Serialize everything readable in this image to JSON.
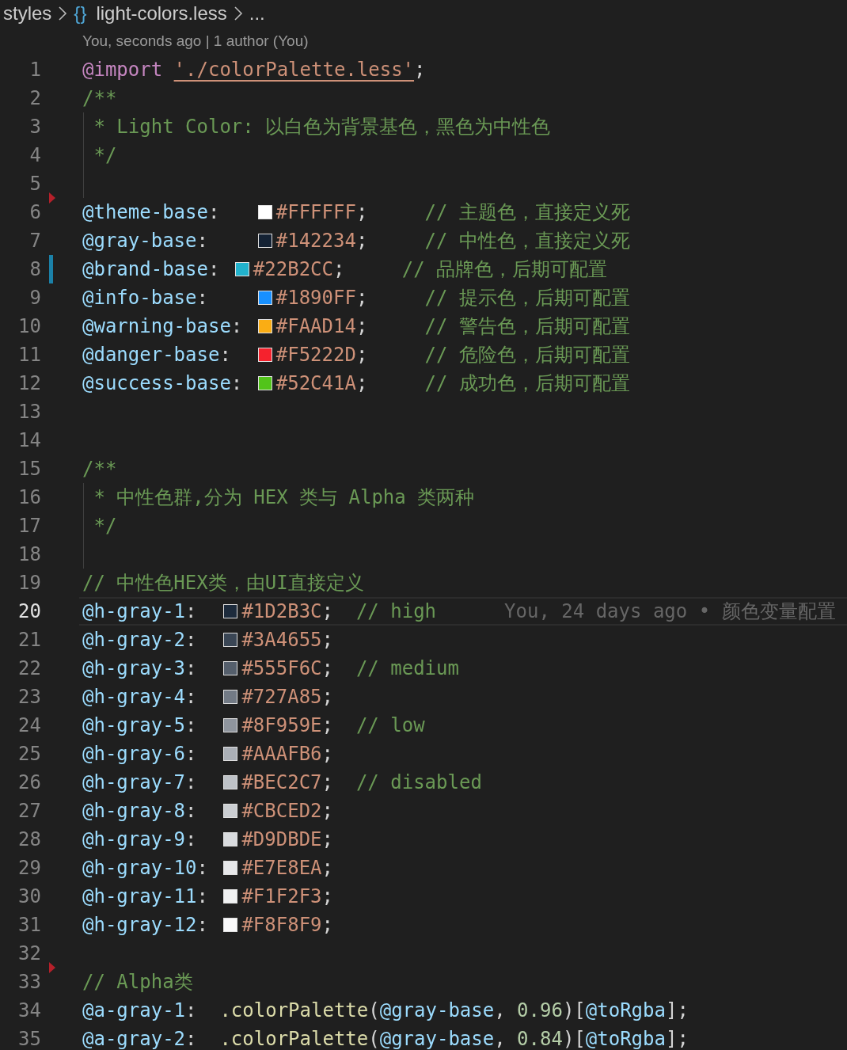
{
  "breadcrumbs": [
    {
      "text": "styles"
    },
    {
      "icon": "{}",
      "text": "light-colors.less"
    },
    {
      "text": "..."
    }
  ],
  "codelens": "You, seconds ago | 1 author (You)",
  "lines": [
    {
      "number": "1",
      "current": false,
      "guide": false,
      "modified": false,
      "deleted": false,
      "tokens": [
        {
          "kind": "kw",
          "text": "@import"
        },
        {
          "kind": "str",
          "text": "'./colorPalette.less'"
        },
        {
          "kind": "punct",
          "text": ";"
        }
      ]
    },
    {
      "number": "2",
      "current": false,
      "guide": false,
      "modified": false,
      "deleted": false,
      "tokens": [
        {
          "kind": "cmt",
          "text": "/**"
        }
      ]
    },
    {
      "number": "3",
      "current": false,
      "guide": true,
      "modified": false,
      "deleted": false,
      "tokens": [
        {
          "kind": "cmt",
          "text": " * Light Color: 以白色为背景基色，黑色为中性色"
        }
      ]
    },
    {
      "number": "4",
      "current": false,
      "guide": true,
      "modified": false,
      "deleted": false,
      "tokens": [
        {
          "kind": "cmt",
          "text": " */"
        }
      ]
    },
    {
      "number": "5",
      "current": false,
      "guide": true,
      "modified": false,
      "deleted": false
    },
    {
      "number": "6",
      "current": false,
      "guide": false,
      "modified": false,
      "deleted": true,
      "tokens": [
        {
          "kind": "var",
          "text": "@theme-base"
        },
        {
          "kind": "punct",
          "text": ":   "
        },
        {
          "kind": "swatch",
          "color": "#ffffff"
        },
        {
          "kind": "hex",
          "text": "#FFFFFF"
        },
        {
          "kind": "punct",
          "text": ";     "
        },
        {
          "kind": "cmt",
          "text": "// 主题色，直接定义死"
        }
      ]
    },
    {
      "number": "7",
      "current": false,
      "guide": false,
      "modified": false,
      "deleted": false,
      "tokens": [
        {
          "kind": "var",
          "text": "@gray-base"
        },
        {
          "kind": "punct",
          "text": ":    "
        },
        {
          "kind": "swatch",
          "color": "#142234"
        },
        {
          "kind": "hex",
          "text": "#142234"
        },
        {
          "kind": "punct",
          "text": ";     "
        },
        {
          "kind": "cmt",
          "text": "// 中性色，直接定义死"
        }
      ]
    },
    {
      "number": "8",
      "current": false,
      "guide": false,
      "modified": true,
      "deleted": false,
      "tokens": [
        {
          "kind": "var",
          "text": "@brand-base"
        },
        {
          "kind": "punct",
          "text": ": "
        },
        {
          "kind": "swatch",
          "color": "#22b2cc"
        },
        {
          "kind": "hex",
          "text": "#22B2CC"
        },
        {
          "kind": "punct",
          "text": ";     "
        },
        {
          "kind": "cmt",
          "text": "// 品牌色，后期可配置"
        }
      ]
    },
    {
      "number": "9",
      "current": false,
      "guide": false,
      "modified": false,
      "deleted": false,
      "tokens": [
        {
          "kind": "var",
          "text": "@info-base"
        },
        {
          "kind": "punct",
          "text": ":    "
        },
        {
          "kind": "swatch",
          "color": "#1890ff"
        },
        {
          "kind": "hex",
          "text": "#1890FF"
        },
        {
          "kind": "punct",
          "text": ";     "
        },
        {
          "kind": "cmt",
          "text": "// 提示色，后期可配置"
        }
      ]
    },
    {
      "number": "10",
      "current": false,
      "guide": false,
      "modified": false,
      "deleted": false,
      "tokens": [
        {
          "kind": "var",
          "text": "@warning-base"
        },
        {
          "kind": "punct",
          "text": ": "
        },
        {
          "kind": "swatch",
          "color": "#faad14"
        },
        {
          "kind": "hex",
          "text": "#FAAD14"
        },
        {
          "kind": "punct",
          "text": ";     "
        },
        {
          "kind": "cmt",
          "text": "// 警告色，后期可配置"
        }
      ]
    },
    {
      "number": "11",
      "current": false,
      "guide": false,
      "modified": false,
      "deleted": false,
      "tokens": [
        {
          "kind": "var",
          "text": "@danger-base"
        },
        {
          "kind": "punct",
          "text": ":  "
        },
        {
          "kind": "swatch",
          "color": "#f5222d"
        },
        {
          "kind": "hex",
          "text": "#F5222D"
        },
        {
          "kind": "punct",
          "text": ";     "
        },
        {
          "kind": "cmt",
          "text": "// 危险色，后期可配置"
        }
      ]
    },
    {
      "number": "12",
      "current": false,
      "guide": false,
      "modified": false,
      "deleted": false,
      "tokens": [
        {
          "kind": "var",
          "text": "@success-base"
        },
        {
          "kind": "punct",
          "text": ": "
        },
        {
          "kind": "swatch",
          "color": "#52c41a"
        },
        {
          "kind": "hex",
          "text": "#52C41A"
        },
        {
          "kind": "punct",
          "text": ";     "
        },
        {
          "kind": "cmt",
          "text": "// 成功色，后期可配置"
        }
      ]
    },
    {
      "number": "13",
      "current": false,
      "guide": false,
      "modified": false,
      "deleted": false
    },
    {
      "number": "14",
      "current": false,
      "guide": false,
      "modified": false,
      "deleted": false
    },
    {
      "number": "15",
      "current": false,
      "guide": false,
      "modified": false,
      "deleted": false,
      "tokens": [
        {
          "kind": "cmt",
          "text": "/**"
        }
      ]
    },
    {
      "number": "16",
      "current": false,
      "guide": true,
      "modified": false,
      "deleted": false,
      "tokens": [
        {
          "kind": "cmt",
          "text": " * 中性色群,分为 HEX 类与 Alpha 类两种"
        }
      ]
    },
    {
      "number": "17",
      "current": false,
      "guide": true,
      "modified": false,
      "deleted": false,
      "tokens": [
        {
          "kind": "cmt",
          "text": " */"
        }
      ]
    },
    {
      "number": "18",
      "current": false,
      "guide": true,
      "modified": false,
      "deleted": false
    },
    {
      "number": "19",
      "current": false,
      "guide": false,
      "modified": false,
      "deleted": false,
      "tokens": [
        {
          "kind": "cmt",
          "text": "// 中性色HEX类，由UI直接定义"
        }
      ]
    },
    {
      "number": "20",
      "current": true,
      "guide": false,
      "modified": false,
      "deleted": false,
      "tokens": [
        {
          "kind": "var",
          "text": "@h-gray-1"
        },
        {
          "kind": "punct",
          "text": ":  "
        },
        {
          "kind": "swatch",
          "color": "#1d2b3c"
        },
        {
          "kind": "hex",
          "text": "#1D2B3C"
        },
        {
          "kind": "punct",
          "text": ";  "
        },
        {
          "kind": "cmt",
          "text": "// high"
        },
        {
          "kind": "blame",
          "text": "You, 24 days ago • 颜色变量配置"
        }
      ]
    },
    {
      "number": "21",
      "current": false,
      "guide": false,
      "modified": false,
      "deleted": false,
      "tokens": [
        {
          "kind": "var",
          "text": "@h-gray-2"
        },
        {
          "kind": "punct",
          "text": ":  "
        },
        {
          "kind": "swatch",
          "color": "#3a4655"
        },
        {
          "kind": "hex",
          "text": "#3A4655"
        },
        {
          "kind": "punct",
          "text": ";"
        }
      ]
    },
    {
      "number": "22",
      "current": false,
      "guide": false,
      "modified": false,
      "deleted": false,
      "tokens": [
        {
          "kind": "var",
          "text": "@h-gray-3"
        },
        {
          "kind": "punct",
          "text": ":  "
        },
        {
          "kind": "swatch",
          "color": "#555f6c"
        },
        {
          "kind": "hex",
          "text": "#555F6C"
        },
        {
          "kind": "punct",
          "text": ";  "
        },
        {
          "kind": "cmt",
          "text": "// medium"
        }
      ]
    },
    {
      "number": "23",
      "current": false,
      "guide": false,
      "modified": false,
      "deleted": false,
      "tokens": [
        {
          "kind": "var",
          "text": "@h-gray-4"
        },
        {
          "kind": "punct",
          "text": ":  "
        },
        {
          "kind": "swatch",
          "color": "#727a85"
        },
        {
          "kind": "hex",
          "text": "#727A85"
        },
        {
          "kind": "punct",
          "text": ";"
        }
      ]
    },
    {
      "number": "24",
      "current": false,
      "guide": false,
      "modified": false,
      "deleted": false,
      "tokens": [
        {
          "kind": "var",
          "text": "@h-gray-5"
        },
        {
          "kind": "punct",
          "text": ":  "
        },
        {
          "kind": "swatch",
          "color": "#8f959e"
        },
        {
          "kind": "hex",
          "text": "#8F959E"
        },
        {
          "kind": "punct",
          "text": ";  "
        },
        {
          "kind": "cmt",
          "text": "// low"
        }
      ]
    },
    {
      "number": "25",
      "current": false,
      "guide": false,
      "modified": false,
      "deleted": false,
      "tokens": [
        {
          "kind": "var",
          "text": "@h-gray-6"
        },
        {
          "kind": "punct",
          "text": ":  "
        },
        {
          "kind": "swatch",
          "color": "#aaafb6"
        },
        {
          "kind": "hex",
          "text": "#AAAFB6"
        },
        {
          "kind": "punct",
          "text": ";"
        }
      ]
    },
    {
      "number": "26",
      "current": false,
      "guide": false,
      "modified": false,
      "deleted": false,
      "tokens": [
        {
          "kind": "var",
          "text": "@h-gray-7"
        },
        {
          "kind": "punct",
          "text": ":  "
        },
        {
          "kind": "swatch",
          "color": "#bec2c7"
        },
        {
          "kind": "hex",
          "text": "#BEC2C7"
        },
        {
          "kind": "punct",
          "text": ";  "
        },
        {
          "kind": "cmt",
          "text": "// disabled"
        }
      ]
    },
    {
      "number": "27",
      "current": false,
      "guide": false,
      "modified": false,
      "deleted": false,
      "tokens": [
        {
          "kind": "var",
          "text": "@h-gray-8"
        },
        {
          "kind": "punct",
          "text": ":  "
        },
        {
          "kind": "swatch",
          "color": "#cbced2"
        },
        {
          "kind": "hex",
          "text": "#CBCED2"
        },
        {
          "kind": "punct",
          "text": ";"
        }
      ]
    },
    {
      "number": "28",
      "current": false,
      "guide": false,
      "modified": false,
      "deleted": false,
      "tokens": [
        {
          "kind": "var",
          "text": "@h-gray-9"
        },
        {
          "kind": "punct",
          "text": ":  "
        },
        {
          "kind": "swatch",
          "color": "#d9dbde"
        },
        {
          "kind": "hex",
          "text": "#D9DBDE"
        },
        {
          "kind": "punct",
          "text": ";"
        }
      ]
    },
    {
      "number": "29",
      "current": false,
      "guide": false,
      "modified": false,
      "deleted": false,
      "tokens": [
        {
          "kind": "var",
          "text": "@h-gray-10"
        },
        {
          "kind": "punct",
          "text": ": "
        },
        {
          "kind": "swatch",
          "color": "#e7e8ea"
        },
        {
          "kind": "hex",
          "text": "#E7E8EA"
        },
        {
          "kind": "punct",
          "text": ";"
        }
      ]
    },
    {
      "number": "30",
      "current": false,
      "guide": false,
      "modified": false,
      "deleted": false,
      "tokens": [
        {
          "kind": "var",
          "text": "@h-gray-11"
        },
        {
          "kind": "punct",
          "text": ": "
        },
        {
          "kind": "swatch",
          "color": "#f1f2f3"
        },
        {
          "kind": "hex",
          "text": "#F1F2F3"
        },
        {
          "kind": "punct",
          "text": ";"
        }
      ]
    },
    {
      "number": "31",
      "current": false,
      "guide": false,
      "modified": false,
      "deleted": false,
      "tokens": [
        {
          "kind": "var",
          "text": "@h-gray-12"
        },
        {
          "kind": "punct",
          "text": ": "
        },
        {
          "kind": "swatch",
          "color": "#f8f8f9"
        },
        {
          "kind": "hex",
          "text": "#F8F8F9"
        },
        {
          "kind": "punct",
          "text": ";"
        }
      ]
    },
    {
      "number": "32",
      "current": false,
      "guide": false,
      "modified": false,
      "deleted": false
    },
    {
      "number": "33",
      "current": false,
      "guide": false,
      "modified": false,
      "deleted": true,
      "tokens": [
        {
          "kind": "cmt",
          "text": "// Alpha类"
        }
      ]
    },
    {
      "number": "34",
      "current": false,
      "guide": false,
      "modified": false,
      "deleted": false,
      "tokens": [
        {
          "kind": "var",
          "text": "@a-gray-1"
        },
        {
          "kind": "punct",
          "text": ":  "
        },
        {
          "kind": "fn",
          "text": ".colorPalette"
        },
        {
          "kind": "punct",
          "text": "("
        },
        {
          "kind": "var",
          "text": "@gray-base"
        },
        {
          "kind": "punct",
          "text": ", "
        },
        {
          "kind": "num",
          "text": "0.96"
        },
        {
          "kind": "punct",
          "text": ")["
        },
        {
          "kind": "var",
          "text": "@toRgba"
        },
        {
          "kind": "punct",
          "text": "];"
        }
      ]
    },
    {
      "number": "35",
      "current": false,
      "guide": false,
      "modified": false,
      "deleted": false,
      "tokens": [
        {
          "kind": "var",
          "text": "@a-gray-2"
        },
        {
          "kind": "punct",
          "text": ":  "
        },
        {
          "kind": "fn",
          "text": ".colorPalette"
        },
        {
          "kind": "punct",
          "text": "("
        },
        {
          "kind": "var",
          "text": "@gray-base"
        },
        {
          "kind": "punct",
          "text": ", "
        },
        {
          "kind": "num",
          "text": "0.84"
        },
        {
          "kind": "punct",
          "text": ")["
        },
        {
          "kind": "var",
          "text": "@toRgba"
        },
        {
          "kind": "punct",
          "text": "];"
        }
      ]
    }
  ]
}
